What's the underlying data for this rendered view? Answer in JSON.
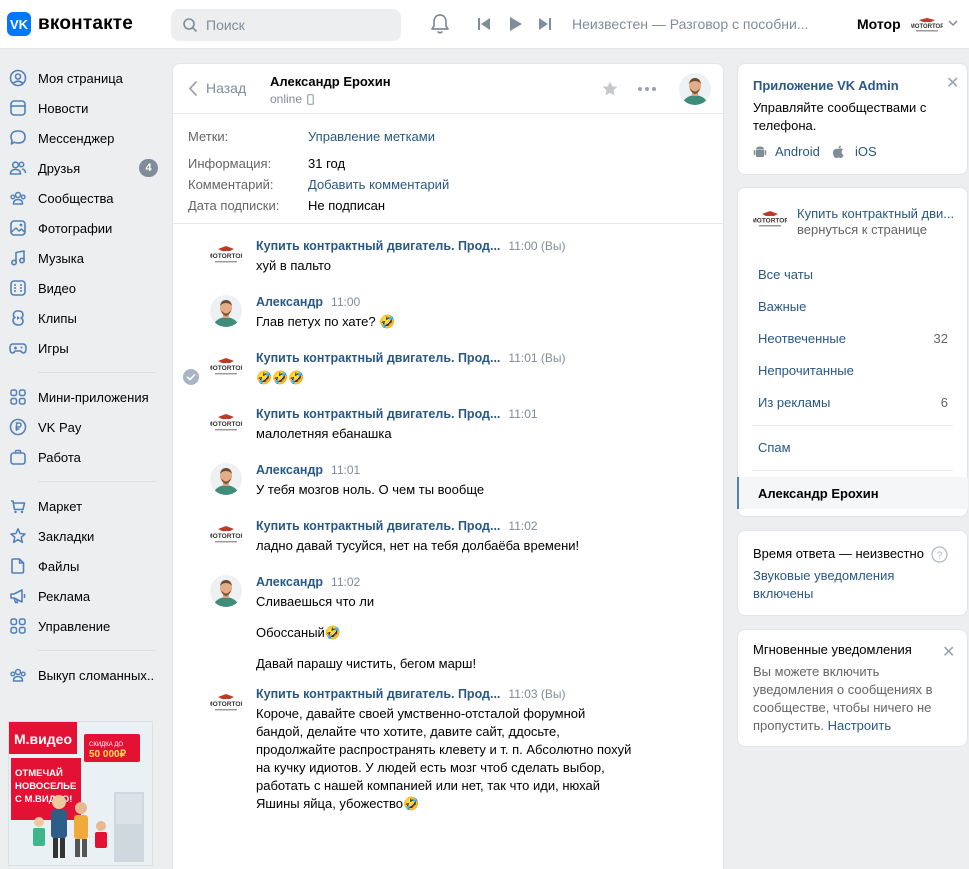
{
  "header": {
    "logo_text": "вконтакте",
    "logo_mark": "VK",
    "search_placeholder": "Поиск",
    "player_title": "Неизвестен — Разговор с пособни...",
    "user_name": "Мотор",
    "brand_color": "#0077ff"
  },
  "nav": {
    "items": [
      {
        "label": "Моя страница",
        "icon": "user-circle-icon"
      },
      {
        "label": "Новости",
        "icon": "news-icon"
      },
      {
        "label": "Мессенджер",
        "icon": "message-icon"
      },
      {
        "label": "Друзья",
        "icon": "friends-icon",
        "badge": "4"
      },
      {
        "label": "Сообщества",
        "icon": "communities-icon"
      },
      {
        "label": "Фотографии",
        "icon": "photo-icon"
      },
      {
        "label": "Музыка",
        "icon": "music-icon"
      },
      {
        "label": "Видео",
        "icon": "video-icon"
      },
      {
        "label": "Клипы",
        "icon": "clips-icon"
      },
      {
        "label": "Игры",
        "icon": "games-icon"
      },
      {
        "label": "Мини-приложения",
        "icon": "apps-icon"
      },
      {
        "label": "VK Pay",
        "icon": "vkpay-icon"
      },
      {
        "label": "Работа",
        "icon": "work-icon"
      },
      {
        "label": "Маркет",
        "icon": "market-icon"
      },
      {
        "label": "Закладки",
        "icon": "bookmark-icon"
      },
      {
        "label": "Файлы",
        "icon": "file-icon"
      },
      {
        "label": "Реклама",
        "icon": "ads-icon"
      },
      {
        "label": "Управление",
        "icon": "manage-icon"
      },
      {
        "label": "Выкуп сломанных..",
        "icon": "group-icon"
      }
    ]
  },
  "ad": {
    "brand": "М.видео",
    "headline": "ОТМЕЧАЙ НОВОСЕЛЬЕ С М.ВИДЕО!",
    "discount": "СКИДКА ДО 50 000 ₽"
  },
  "chat": {
    "back_label": "Назад",
    "peer_name": "Александр Ерохин",
    "peer_status": "online",
    "info": {
      "tags_label": "Метки:",
      "tags_value": "Управление метками",
      "info_label": "Информация:",
      "info_value": "31 год",
      "comment_label": "Комментарий:",
      "comment_value": "Добавить комментарий",
      "sub_label": "Дата подписки:",
      "sub_value": "Не подписан"
    },
    "messages": [
      {
        "author": "Купить контрактный двигатель. Прод...",
        "time": "11:00 (Вы)",
        "lines": [
          "хуй в пальто"
        ],
        "sender": "group"
      },
      {
        "author": "Александр",
        "time": "11:00",
        "lines": [
          "Глав петух по хате? 🤣"
        ],
        "sender": "user"
      },
      {
        "author": "Купить контрактный двигатель. Прод...",
        "time": "11:01 (Вы)",
        "lines": [
          "🤣🤣🤣"
        ],
        "sender": "group"
      },
      {
        "author": "Купить контрактный двигатель. Прод...",
        "time": "11:01",
        "lines": [
          "малолетняя ебанашка"
        ],
        "sender": "group"
      },
      {
        "author": "Александр",
        "time": "11:01",
        "lines": [
          "У тебя мозгов ноль. О чем ты вообще"
        ],
        "sender": "user"
      },
      {
        "author": "Купить контрактный двигатель. Прод...",
        "time": "11:02",
        "lines": [
          "ладно давай тусуйся, нет на тебя долбаёба времени!"
        ],
        "sender": "group"
      },
      {
        "author": "Александр",
        "time": "11:02",
        "lines": [
          "Сливаешься что ли",
          "Обоссаный🤣",
          "Давай парашу чистить, бегом марш!"
        ],
        "sender": "user"
      },
      {
        "author": "Купить контрактный двигатель. Прод...",
        "time": "11:03 (Вы)",
        "lines": [
          "Короче, давайте своей умственно-отсталой форумной бандой, делайте что хотите, давите сайт, ддосьте, продолжайте распространять клевету и т. п. Абсолютно похуй на кучку идиотов. У людей есть мозг чтоб сделать выбор, работать с нашей компанией или нет, так что иди, нюхай Яшины яйца, убожество🤣"
        ],
        "sender": "group"
      }
    ]
  },
  "right": {
    "admin": {
      "title": "Приложение VK Admin",
      "text": "Управляйте сообществами с телефона.",
      "android": "Android",
      "ios": "iOS"
    },
    "community": {
      "name": "Купить контрактный дви...",
      "return": "вернуться к странице"
    },
    "folders": [
      {
        "label": "Все чаты",
        "count": ""
      },
      {
        "label": "Важные",
        "count": ""
      },
      {
        "label": "Неотвеченные",
        "count": "32"
      },
      {
        "label": "Непрочитанные",
        "count": ""
      },
      {
        "label": "Из рекламы",
        "count": "6"
      }
    ],
    "spam": "Спам",
    "active_chat": "Александр Ерохин",
    "response": {
      "text": "Время ответа — неизвестно",
      "sound": "Звуковые уведомления включены"
    },
    "instant": {
      "title": "Мгновенные уведомления",
      "text": "Вы можете включить уведомления о сообщениях в сообществе, чтобы ничего не пропустить.",
      "link": "Настроить"
    }
  },
  "brand_logo_text": "MOTORTOP"
}
